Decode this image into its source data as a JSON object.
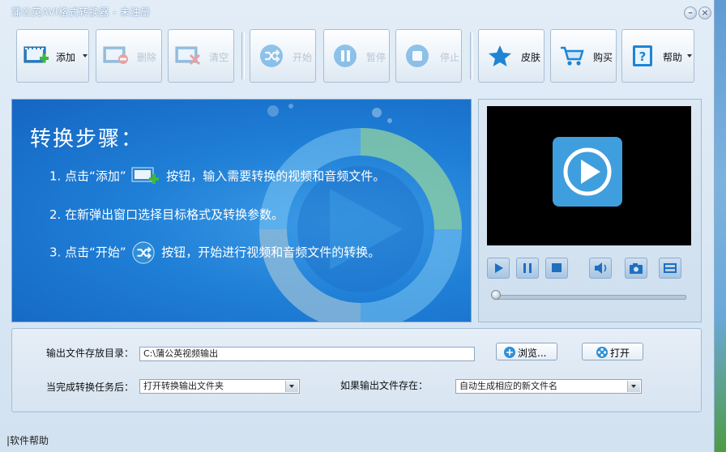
{
  "window": {
    "title": "蒲公英AVI格式转换器 - 未注册"
  },
  "toolbar": {
    "add_label": "添加",
    "delete_label": "删除",
    "clear_label": "清空",
    "start_label": "开始",
    "pause_label": "暂停",
    "stop_label": "停止",
    "skin_label": "皮肤",
    "buy_label": "购买",
    "help_label": "帮助"
  },
  "banner": {
    "heading": "转换步骤：",
    "step1_a": "1. 点击“添加”",
    "step1_b": "按钮，输入需要转换的视频和音频文件。",
    "step2": "2. 在新弹出窗口选择目标格式及转换参数。",
    "step3_a": "3. 点击“开始”",
    "step3_b": "按钮，开始进行视频和音频文件的转换。"
  },
  "settings": {
    "output_dir_label": "输出文件存放目录：",
    "output_dir_value": "C:\\蒲公英视频输出",
    "browse_label": "浏览...",
    "open_label": "打开",
    "after_task_label": "当完成转换任务后：",
    "after_task_value": "打开转换输出文件夹",
    "if_exists_label": "如果输出文件存在：",
    "if_exists_value": "自动生成相应的新文件名"
  },
  "statusbar": {
    "text": "|软件帮助"
  },
  "colors": {
    "accent": "#1f7fd6",
    "add_green": "#3fb83a",
    "delete_red": "#e0443a"
  }
}
